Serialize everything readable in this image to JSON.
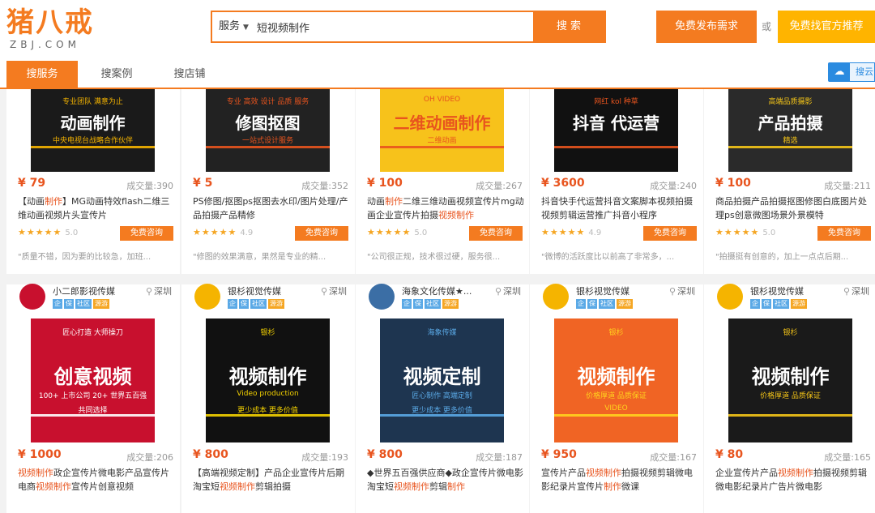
{
  "header": {
    "logo_text": "猪八戒",
    "logo_sub": "ZBJ.COM",
    "search_category": "服务",
    "search_value": "短视频制作",
    "search_button": "搜 索",
    "post_button": "免费发布需求",
    "or_text": "或",
    "official_button": "免费找官方推荐"
  },
  "tabs": [
    {
      "label": "搜服务",
      "active": true
    },
    {
      "label": "搜案例",
      "active": false
    },
    {
      "label": "搜店铺",
      "active": false
    }
  ],
  "cloud_button": {
    "label": "搜云"
  },
  "top_cards": [
    {
      "thumb_title": "动画制作",
      "thumb_lines": [
        "专业团队 满意为止",
        "中央电视台战略合作伙伴"
      ],
      "price": "¥ 79",
      "sold": "成交量:390",
      "title": "【动画制作】MG动画特效flash二维三维动画视频片头宣传片",
      "stars": "★★★★★",
      "rating": "5.0",
      "consult": "免费咨询",
      "review": "\"质量不错，因为要的比较急，加班...",
      "colors": {
        "bg": "#1a1a1a",
        "accent": "#f5b400"
      }
    },
    {
      "thumb_title": "修图抠图",
      "thumb_lines": [
        "专业 高效 设计 品质 服务",
        "一站式设计服务"
      ],
      "price": "¥ 5",
      "sold": "成交量:352",
      "title": "PS修图/抠图ps抠图去水印/图片处理/产品拍摄产品精修",
      "stars": "★★★★★",
      "rating": "4.9",
      "consult": "免费咨询",
      "review": "\"修图的效果满意，果然是专业的精...",
      "colors": {
        "bg": "#222222",
        "accent": "#e8541e"
      }
    },
    {
      "thumb_title": "二维动画制作",
      "thumb_lines": [
        "OH VIDEO",
        "二维动画"
      ],
      "price": "¥ 100",
      "sold": "成交量:267",
      "title": "动画制作二维三维动画视频宣传片mg动画企业宣传片拍摄视频制作",
      "stars": "★★★★★",
      "rating": "5.0",
      "consult": "免费咨询",
      "review": "\"公司很正规，技术很过硬，服务很...",
      "colors": {
        "bg": "#f7c21b",
        "accent": "#e8541e"
      }
    },
    {
      "thumb_title": "抖音 代运营",
      "thumb_lines": [
        "网红 kol 种草"
      ],
      "price": "¥ 3600",
      "sold": "成交量:240",
      "title": "抖音快手代运营抖音文案脚本视频拍摄视频剪辑运营推广抖音小程序",
      "stars": "★★★★★",
      "rating": "4.9",
      "consult": "免费咨询",
      "review": "\"微博的活跃度比以前高了非常多，...",
      "colors": {
        "bg": "#111111",
        "accent": "#e8541e"
      }
    },
    {
      "thumb_title": "产品拍摄",
      "thumb_lines": [
        "高端品质摄影",
        "精选"
      ],
      "price": "¥ 100",
      "sold": "成交量:211",
      "title": "商品拍摄产品拍摄抠图修图白底图片处理ps创意微图场景外景模特",
      "stars": "★★★★★",
      "rating": "5.0",
      "consult": "免费咨询",
      "review": "\"拍摄挺有创意的，加上一点点后期...",
      "colors": {
        "bg": "#2a2a2a",
        "accent": "#f5c518"
      }
    }
  ],
  "bottom_cards": [
    {
      "shop": "小二郎影视传媒",
      "location": "深圳",
      "badges": [
        "企",
        "保",
        "社区",
        "源游"
      ],
      "thumb_title": "创意视频",
      "thumb_lines": [
        "匠心打造 大师操刀",
        "100+ 上市公司 20+ 世界五百强",
        "共同选择"
      ],
      "price": "¥ 1000",
      "sold": "成交量:206",
      "title": "视频制作政企宣传片微电影产品宣传片电商视频制作宣传片创意视频",
      "avatar_color": "#c8102e",
      "colors": {
        "bg": "#c8102e",
        "accent": "#ffffff"
      }
    },
    {
      "shop": "银杉视觉传媒",
      "location": "深圳",
      "badges": [
        "企",
        "保",
        "社区",
        "源游"
      ],
      "thumb_title": "视频制作",
      "thumb_lines": [
        "银杉",
        "Video production",
        "更少成本 更多价值"
      ],
      "price": "¥ 800",
      "sold": "成交量:193",
      "title": "【高端视频定制】产品企业宣传片后期淘宝短视频制作剪辑拍摄",
      "avatar_color": "#f5b400",
      "colors": {
        "bg": "#111111",
        "accent": "#f5d300"
      }
    },
    {
      "shop": "海象文化传媒★...",
      "location": "深圳",
      "badges": [
        "企",
        "保",
        "社区",
        "源游"
      ],
      "thumb_title": "视频定制",
      "thumb_lines": [
        "海象传媒",
        "匠心制作 高端定制",
        "更少成本 更多价值"
      ],
      "price": "¥ 800",
      "sold": "成交量:187",
      "title": "◆世界五百强供应商◆政企宣传片微电影淘宝短视频制作剪辑制作",
      "avatar_color": "#3b6ea5",
      "colors": {
        "bg": "#1e3550",
        "accent": "#5aa9e6"
      }
    },
    {
      "shop": "银杉视觉传媒",
      "location": "深圳",
      "badges": [
        "企",
        "保",
        "社区",
        "源游"
      ],
      "thumb_title": "视频制作",
      "thumb_lines": [
        "银杉",
        "价格厚道 品质保证",
        "VIDEO"
      ],
      "price": "¥ 950",
      "sold": "成交量:167",
      "title": "宣传片产品视频制作拍摄视频剪辑微电影纪录片宣传片制作微课",
      "avatar_color": "#f5b400",
      "colors": {
        "bg": "#f06424",
        "accent": "#ffd21e"
      }
    },
    {
      "shop": "银杉视觉传媒",
      "location": "深圳",
      "badges": [
        "企",
        "保",
        "社区",
        "源游"
      ],
      "thumb_title": "视频制作",
      "thumb_lines": [
        "银杉",
        "价格厚道 品质保证"
      ],
      "price": "¥ 80",
      "sold": "成交量:165",
      "title": "企业宣传片产品视频制作拍摄视频剪辑微电影纪录片广告片微电影",
      "avatar_color": "#f5b400",
      "colors": {
        "bg": "#1a1a1a",
        "accent": "#f5c518"
      }
    }
  ]
}
